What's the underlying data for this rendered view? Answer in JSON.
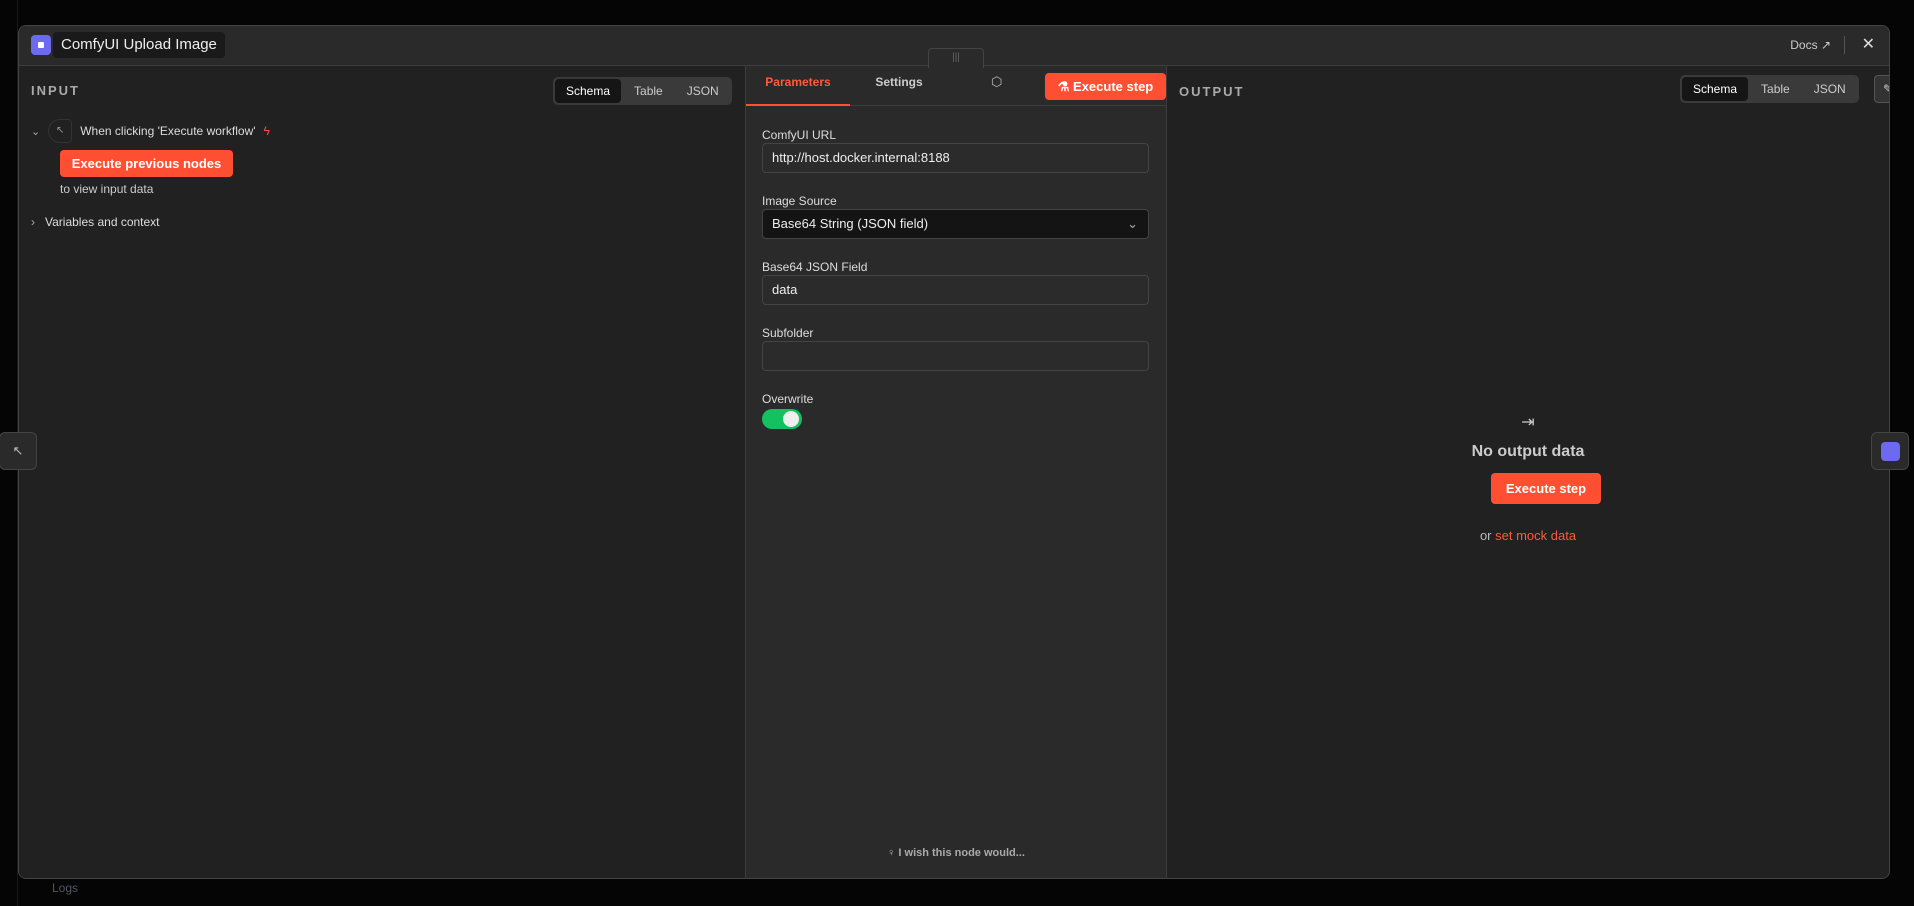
{
  "background": {
    "logs_label": "Logs"
  },
  "header": {
    "title": "ComfyUI Upload Image",
    "docs_label": "Docs",
    "close_icon": "close-icon"
  },
  "input": {
    "section_title": "INPUT",
    "view_tabs": [
      "Schema",
      "Table",
      "JSON"
    ],
    "active_tab": "Schema",
    "trigger_label": "When clicking 'Execute workflow'",
    "execute_previous_label": "Execute previous nodes",
    "hint": "to view input data",
    "variables_label": "Variables and context"
  },
  "parameters": {
    "tabs": [
      "Parameters",
      "Settings"
    ],
    "active_tab": "Parameters",
    "execute_step_label": "Execute step",
    "fields": {
      "comfyui_url": {
        "label": "ComfyUI URL",
        "value": "http://host.docker.internal:8188"
      },
      "image_source": {
        "label": "Image Source",
        "value": "Base64 String (JSON field)"
      },
      "base64_field": {
        "label": "Base64 JSON Field",
        "value": "data"
      },
      "subfolder": {
        "label": "Subfolder",
        "value": ""
      },
      "overwrite": {
        "label": "Overwrite",
        "value": true
      }
    },
    "feedback_label": "I wish this node would..."
  },
  "output": {
    "section_title": "OUTPUT",
    "view_tabs": [
      "Schema",
      "Table",
      "JSON"
    ],
    "active_tab": "Schema",
    "empty_title": "No output data",
    "execute_step_label": "Execute step",
    "or_label": "or",
    "mock_link": "set mock data"
  },
  "colors": {
    "accent": "#ff4f33",
    "toggle_on": "#13c160",
    "node_icon": "#6b6af0"
  }
}
